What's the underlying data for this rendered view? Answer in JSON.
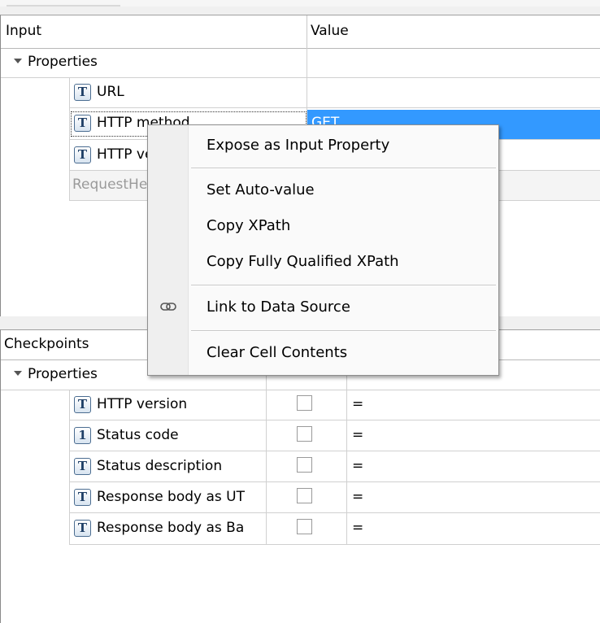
{
  "input_panel": {
    "columns": {
      "input": "Input",
      "value": "Value"
    },
    "group": "Properties",
    "rows": [
      {
        "icon": "T",
        "label": "URL",
        "value": ""
      },
      {
        "icon": "T",
        "label": "HTTP method",
        "value": "GET"
      },
      {
        "icon": "T",
        "label": "HTTP version",
        "value": ""
      },
      {
        "icon": "",
        "label": "RequestHeaders",
        "value": ""
      }
    ]
  },
  "context_menu": {
    "items": [
      {
        "label": "Expose as Input Property",
        "icon": ""
      },
      {
        "label": "Set Auto-value",
        "icon": ""
      },
      {
        "label": "Copy XPath",
        "icon": ""
      },
      {
        "label": "Copy Fully Qualified XPath",
        "icon": ""
      },
      {
        "label": "Link to Data Source",
        "icon": "link-icon"
      },
      {
        "label": "Clear Cell Contents",
        "icon": ""
      }
    ]
  },
  "checkpoints_panel": {
    "header": "Checkpoints",
    "group": "Properties",
    "rows": [
      {
        "icon": "T",
        "label": "HTTP version",
        "checked": false,
        "operator": "="
      },
      {
        "icon": "1",
        "label": "Status code",
        "checked": false,
        "operator": "="
      },
      {
        "icon": "T",
        "label": "Status description",
        "checked": false,
        "operator": "="
      },
      {
        "icon": "T",
        "label": "Response body as UT",
        "checked": false,
        "operator": "="
      },
      {
        "icon": "T",
        "label": "Response body as Ba",
        "checked": false,
        "operator": "="
      }
    ]
  }
}
